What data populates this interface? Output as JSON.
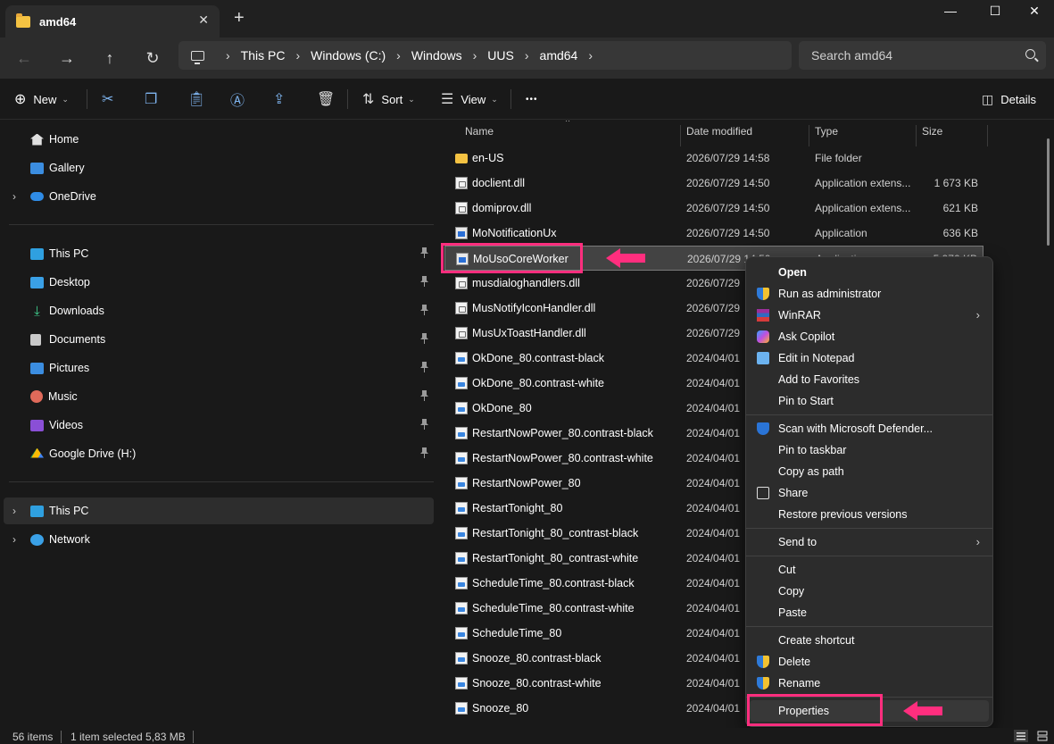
{
  "window": {
    "tab_title": "amd64",
    "tab_close": "✕",
    "new_tab": "+",
    "minimize": "—",
    "maximize": "☐",
    "close": "✕"
  },
  "nav": {
    "back": "←",
    "forward": "→",
    "up": "↑",
    "refresh": "↻",
    "breadcrumb": [
      "This PC",
      "Windows (C:)",
      "Windows",
      "UUS",
      "amd64"
    ],
    "crumb_sep": "›",
    "search_placeholder": "Search amd64"
  },
  "commands": {
    "new": "New",
    "sort": "Sort",
    "view": "View",
    "more": "•••",
    "details": "Details"
  },
  "sidebar": {
    "quick": [
      {
        "label": "Home",
        "icon": "home-icon",
        "expandable": false
      },
      {
        "label": "Gallery",
        "icon": "gallery-icon",
        "expandable": false
      },
      {
        "label": "OneDrive",
        "icon": "onedrive-icon",
        "expandable": true
      }
    ],
    "pinned": [
      {
        "label": "This PC",
        "icon": "pc-icon"
      },
      {
        "label": "Desktop",
        "icon": "desktop-icon"
      },
      {
        "label": "Downloads",
        "icon": "downloads-icon"
      },
      {
        "label": "Documents",
        "icon": "documents-icon"
      },
      {
        "label": "Pictures",
        "icon": "pictures-icon"
      },
      {
        "label": "Music",
        "icon": "music-icon"
      },
      {
        "label": "Videos",
        "icon": "videos-icon"
      },
      {
        "label": "Google Drive (H:)",
        "icon": "google-drive-icon"
      }
    ],
    "tree": [
      {
        "label": "This PC",
        "icon": "pc-icon",
        "selected": true
      },
      {
        "label": "Network",
        "icon": "network-icon",
        "selected": false
      }
    ]
  },
  "columns": {
    "name": "Name",
    "date": "Date modified",
    "type": "Type",
    "size": "Size"
  },
  "files": [
    {
      "name": "en-US",
      "date": "2026/07/29 14:58",
      "type": "File folder",
      "size": "",
      "kind": "folder"
    },
    {
      "name": "doclient.dll",
      "date": "2026/07/29 14:50",
      "type": "Application extens...",
      "size": "1 673 KB",
      "kind": "dll"
    },
    {
      "name": "domiprov.dll",
      "date": "2026/07/29 14:50",
      "type": "Application extens...",
      "size": "621 KB",
      "kind": "dll"
    },
    {
      "name": "MoNotificationUx",
      "date": "2026/07/29 14:50",
      "type": "Application",
      "size": "636 KB",
      "kind": "app"
    },
    {
      "name": "MoUsoCoreWorker",
      "date": "2026/07/29 14:50",
      "type": "Application",
      "size": "5 970 KB",
      "kind": "app",
      "selected": true
    },
    {
      "name": "musdialoghandlers.dll",
      "date": "2026/07/29",
      "type": "",
      "size": "",
      "kind": "dll"
    },
    {
      "name": "MusNotifyIconHandler.dll",
      "date": "2026/07/29",
      "type": "",
      "size": "",
      "kind": "dll"
    },
    {
      "name": "MusUxToastHandler.dll",
      "date": "2026/07/29",
      "type": "",
      "size": "",
      "kind": "dll"
    },
    {
      "name": "OkDone_80.contrast-black",
      "date": "2024/04/01",
      "type": "",
      "size": "",
      "kind": "img"
    },
    {
      "name": "OkDone_80.contrast-white",
      "date": "2024/04/01",
      "type": "",
      "size": "",
      "kind": "img"
    },
    {
      "name": "OkDone_80",
      "date": "2024/04/01",
      "type": "",
      "size": "",
      "kind": "img"
    },
    {
      "name": "RestartNowPower_80.contrast-black",
      "date": "2024/04/01",
      "type": "",
      "size": "",
      "kind": "img"
    },
    {
      "name": "RestartNowPower_80.contrast-white",
      "date": "2024/04/01",
      "type": "",
      "size": "",
      "kind": "img"
    },
    {
      "name": "RestartNowPower_80",
      "date": "2024/04/01",
      "type": "",
      "size": "",
      "kind": "img"
    },
    {
      "name": "RestartTonight_80",
      "date": "2024/04/01",
      "type": "",
      "size": "",
      "kind": "img"
    },
    {
      "name": "RestartTonight_80_contrast-black",
      "date": "2024/04/01",
      "type": "",
      "size": "",
      "kind": "img"
    },
    {
      "name": "RestartTonight_80_contrast-white",
      "date": "2024/04/01",
      "type": "",
      "size": "",
      "kind": "img"
    },
    {
      "name": "ScheduleTime_80.contrast-black",
      "date": "2024/04/01",
      "type": "",
      "size": "",
      "kind": "img"
    },
    {
      "name": "ScheduleTime_80.contrast-white",
      "date": "2024/04/01",
      "type": "",
      "size": "",
      "kind": "img"
    },
    {
      "name": "ScheduleTime_80",
      "date": "2024/04/01",
      "type": "",
      "size": "",
      "kind": "img"
    },
    {
      "name": "Snooze_80.contrast-black",
      "date": "2024/04/01",
      "type": "",
      "size": "",
      "kind": "img"
    },
    {
      "name": "Snooze_80.contrast-white",
      "date": "2024/04/01",
      "type": "",
      "size": "",
      "kind": "img"
    },
    {
      "name": "Snooze_80",
      "date": "2024/04/01",
      "type": "",
      "size": "",
      "kind": "img"
    }
  ],
  "context_menu": {
    "groups": [
      [
        {
          "label": "Open",
          "icon": "",
          "bold": true
        },
        {
          "label": "Run as administrator",
          "icon": "shield-icon"
        },
        {
          "label": "WinRAR",
          "icon": "winrar-icon",
          "submenu": true
        },
        {
          "label": "Ask Copilot",
          "icon": "copilot-icon"
        },
        {
          "label": "Edit in Notepad",
          "icon": "notepad-icon"
        },
        {
          "label": "Add to Favorites",
          "icon": ""
        },
        {
          "label": "Pin to Start",
          "icon": ""
        }
      ],
      [
        {
          "label": "Scan with Microsoft Defender...",
          "icon": "defender-icon"
        },
        {
          "label": "Pin to taskbar",
          "icon": ""
        },
        {
          "label": "Copy as path",
          "icon": ""
        },
        {
          "label": "Share",
          "icon": "share-icon"
        },
        {
          "label": "Restore previous versions",
          "icon": ""
        }
      ],
      [
        {
          "label": "Send to",
          "icon": "",
          "submenu": true
        }
      ],
      [
        {
          "label": "Cut",
          "icon": ""
        },
        {
          "label": "Copy",
          "icon": ""
        },
        {
          "label": "Paste",
          "icon": ""
        }
      ],
      [
        {
          "label": "Create shortcut",
          "icon": ""
        },
        {
          "label": "Delete",
          "icon": "shield-icon"
        },
        {
          "label": "Rename",
          "icon": "shield-icon"
        }
      ],
      [
        {
          "label": "Properties",
          "icon": "",
          "highlighted": true
        }
      ]
    ]
  },
  "status": {
    "items": "56 items",
    "selection": "1 item selected  5,83 MB"
  },
  "colors": {
    "annotation": "#ff2e7e",
    "accent": "#7fb5f0"
  }
}
